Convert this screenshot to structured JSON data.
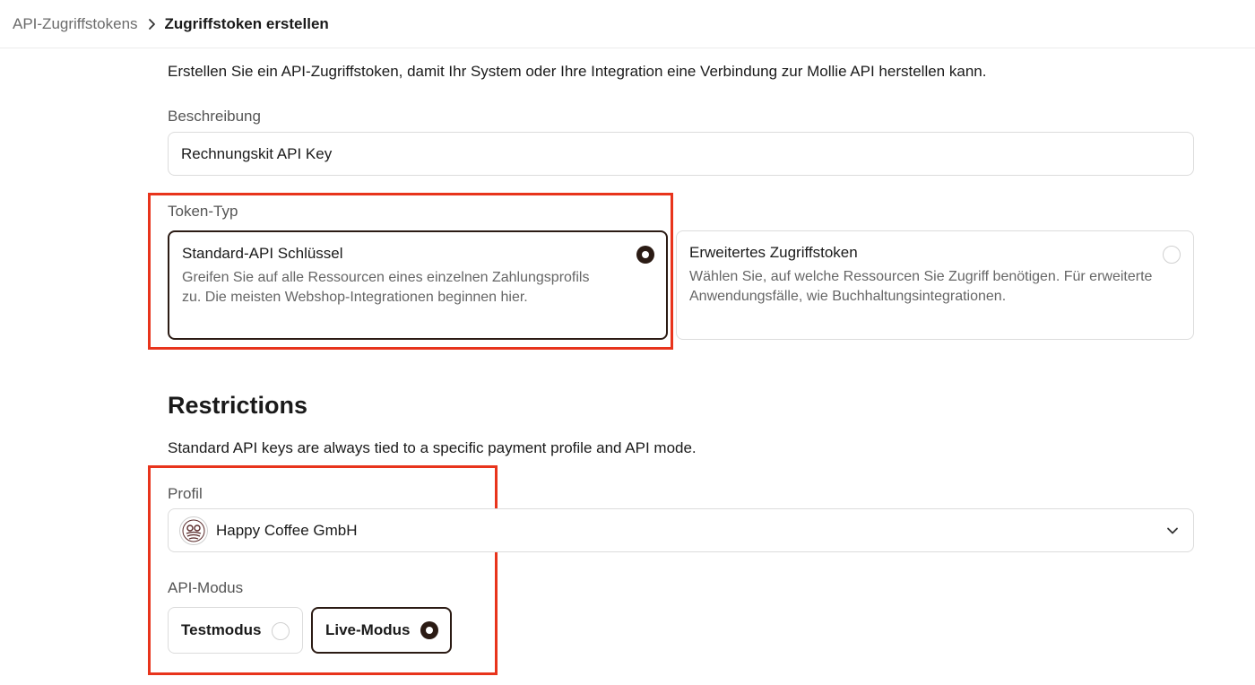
{
  "breadcrumb": {
    "parent": "API-Zugriffstokens",
    "current": "Zugriffstoken erstellen"
  },
  "intro": "Erstellen Sie ein API-Zugriffstoken, damit Ihr System oder Ihre Integration eine Verbindung zur Mollie API herstellen kann.",
  "description_field": {
    "label": "Beschreibung",
    "value": "Rechnungskit API Key"
  },
  "token_type": {
    "label": "Token-Typ",
    "options": [
      {
        "title": "Standard-API Schlüssel",
        "description": "Greifen Sie auf alle Ressourcen eines einzelnen Zahlungsprofils zu. Die meisten Webshop-Integrationen beginnen hier.",
        "selected": true
      },
      {
        "title": "Erweitertes Zugriffstoken",
        "description": "Wählen Sie, auf welche Ressourcen Sie Zugriff benötigen. Für erweiterte Anwendungsfälle, wie Buchhaltungsintegrationen.",
        "selected": false
      }
    ]
  },
  "restrictions": {
    "title": "Restrictions",
    "description": "Standard API keys are always tied to a specific payment profile and API mode.",
    "profile": {
      "label": "Profil",
      "value": "Happy Coffee GmbH",
      "icon": "coffee-logo-icon"
    },
    "api_mode": {
      "label": "API-Modus",
      "options": [
        {
          "label": "Testmodus",
          "selected": false
        },
        {
          "label": "Live-Modus",
          "selected": true
        }
      ]
    }
  },
  "colors": {
    "accent": "#2b1b14",
    "highlight": "#e8341c",
    "border": "#dcdcdc"
  }
}
